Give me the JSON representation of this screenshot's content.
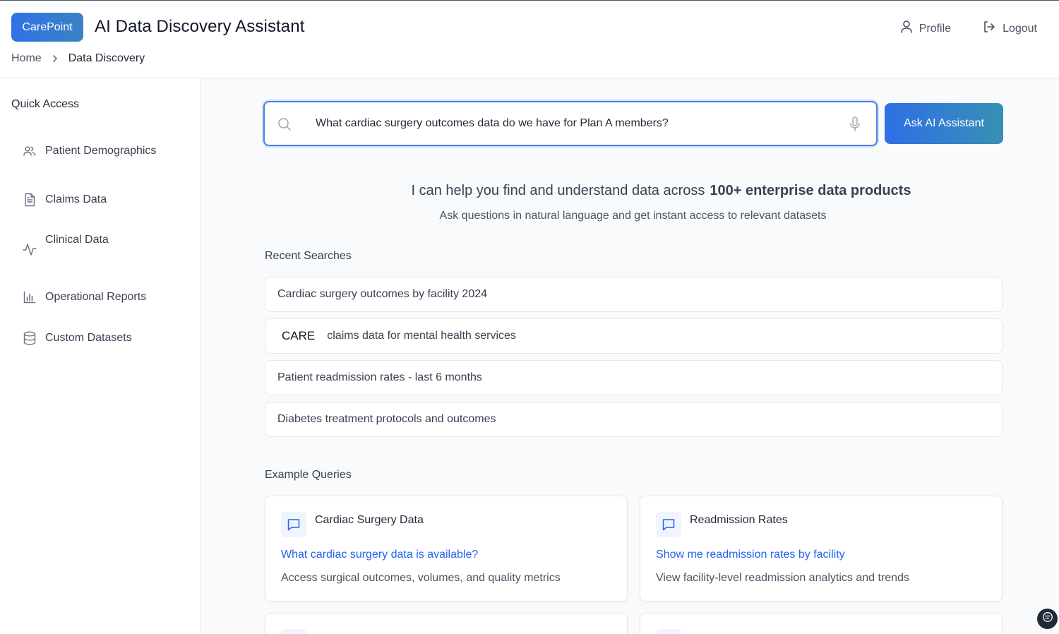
{
  "header": {
    "logo_text": "CarePoint",
    "app_title": "AI Data Discovery Assistant",
    "breadcrumb": {
      "home": "Home",
      "current": "Data Discovery"
    },
    "profile_label": "Profile",
    "logout_label": "Logout"
  },
  "sidebar": {
    "heading": "Quick Access",
    "items": [
      {
        "label": "Patient Demographics",
        "icon": "users-icon"
      },
      {
        "label": "Claims Data",
        "icon": "document-icon"
      },
      {
        "label": "Clinical Data",
        "icon": "activity-icon"
      },
      {
        "label": "Operational Reports",
        "icon": "bar-chart-icon"
      },
      {
        "label": "Custom Datasets",
        "icon": "database-icon"
      }
    ]
  },
  "search": {
    "value": "What cardiac surgery outcomes data do we have for Plan A members?",
    "button_label": "Ask AI Assistant"
  },
  "hero": {
    "title_prefix": "I can help you find and understand data across",
    "title_emphasis": "100+ enterprise data products",
    "subtitle": "Ask questions in natural language and get instant access to relevant datasets"
  },
  "recent": {
    "heading": "Recent Searches",
    "items": [
      {
        "text": "Cardiac surgery outcomes by facility 2024"
      },
      {
        "prefix": "CARE",
        "text": "claims data for mental health services"
      },
      {
        "text": "Patient readmission rates - last 6 months"
      },
      {
        "text": "Diabetes treatment protocols and outcomes"
      }
    ]
  },
  "examples": {
    "heading": "Example Queries",
    "cards": [
      {
        "title": "Cardiac Surgery Data",
        "query": "What cardiac surgery data is available?",
        "description": "Access surgical outcomes, volumes, and quality metrics",
        "icon": "message-icon"
      },
      {
        "title": "Readmission Rates",
        "query": "Show me readmission rates by facility",
        "description": "View facility-level readmission analytics and trends",
        "icon": "message-icon"
      }
    ]
  },
  "colors": {
    "accent": "#2563eb",
    "search_border": "#4b7fe0"
  }
}
